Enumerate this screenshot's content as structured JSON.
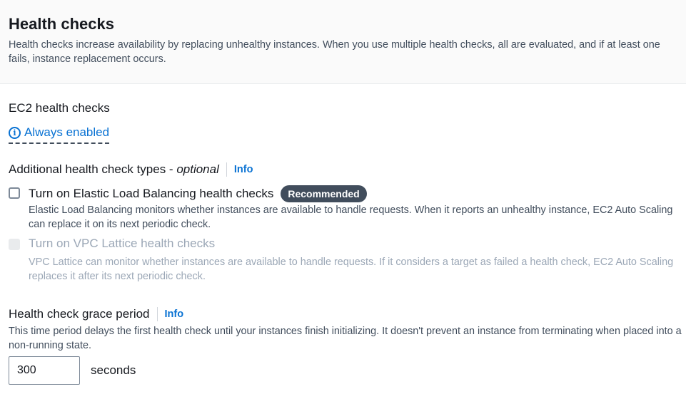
{
  "header": {
    "title": "Health checks",
    "description": "Health checks increase availability by replacing unhealthy instances. When you use multiple health checks, all are evaluated, and if at least one fails, instance replacement occurs."
  },
  "ec2": {
    "label": "EC2 health checks",
    "always_enabled": "Always enabled",
    "icon": "info-icon"
  },
  "additional": {
    "label": "Additional health check types - ",
    "optional": "optional",
    "info": "Info",
    "elb": {
      "label": "Turn on Elastic Load Balancing health checks",
      "badge": "Recommended",
      "checked": false,
      "description": "Elastic Load Balancing monitors whether instances are available to handle requests. When it reports an unhealthy instance, EC2 Auto Scaling can replace it on its next periodic check."
    },
    "vpc": {
      "label": "Turn on VPC Lattice health checks",
      "checked": false,
      "disabled": true,
      "description": "VPC Lattice can monitor whether instances are available to handle requests. If it considers a target as failed a health check, EC2 Auto Scaling replaces it after its next periodic check."
    }
  },
  "grace": {
    "label": "Health check grace period",
    "info": "Info",
    "description": "This time period delays the first health check until your instances finish initializing. It doesn't prevent an instance from terminating when placed into a non-running state.",
    "value": "300",
    "unit": "seconds"
  }
}
